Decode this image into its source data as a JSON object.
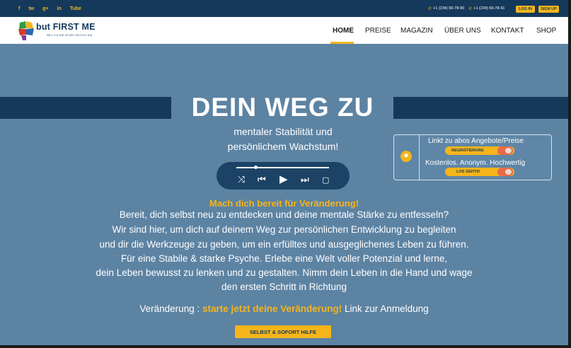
{
  "topbar": {
    "social": [
      "f",
      "tw",
      "g+",
      "in",
      "Tube"
    ],
    "phones": [
      "+1 (234) 56-78-90",
      "+1 (234) 56-78-91"
    ],
    "login_label": "LOG IN",
    "signup_label": "SIGN UP"
  },
  "brand": {
    "title": "but FIRST ME",
    "tagline": "WEIL ICH MIR SELBST WICHTIG BIN"
  },
  "nav": [
    "HOME",
    "PREISE",
    "MAGAZIN",
    "ÜBER UNS",
    "KONTAKT",
    "SHOP"
  ],
  "hero": {
    "title": "DEIN WEG ZU",
    "subtitle_1": "mentaler Stabilität und",
    "subtitle_2": "persönlichem Wachstum!"
  },
  "player": {
    "shuffle_icon": "⤨",
    "prev_icon": "⏮",
    "play_icon": "▶",
    "next_icon": "⏭",
    "stop_icon": "▢"
  },
  "infobox": {
    "line_1": "Linkt zu abos Angebote/Preise",
    "button_1": "REGRISTIERUNG",
    "line_2": "Kostenlos. Anonym. Hochwertig",
    "button_2": "LOS GEHTS!"
  },
  "content": {
    "headline": "Mach dich bereit für Veränderung!",
    "lines": [
      "Bereit, dich selbst neu zu entdecken und deine mentale Stärke zu entfesseln?",
      "Wir sind hier, um dich auf deinem Weg zur persönlichen Entwicklung zu begleiten",
      "und dir die Werkzeuge zu geben, um ein erfülltes und ausgeglichenes Leben zu führen.",
      "Für eine Stabile & starke Psyche. Erlebe eine Welt voller Potenzial und lerne,",
      "dein Leben bewusst zu lenken und zu gestalten. Nimm dein Leben in die Hand und wage",
      "den ersten Schritt in Richtung"
    ],
    "cta_prefix": "Veränderung : ",
    "cta_highlight": "starte jetzt deine Veränderung!",
    "cta_suffix": "  Link zur Anmeldung",
    "cta_button": "SELBST & SOFORT HILFE"
  },
  "colors": {
    "navy": "#15395b",
    "accent": "#f5b51b",
    "hero_bg": "#5d83a3",
    "toggle": "#e86a4a"
  }
}
